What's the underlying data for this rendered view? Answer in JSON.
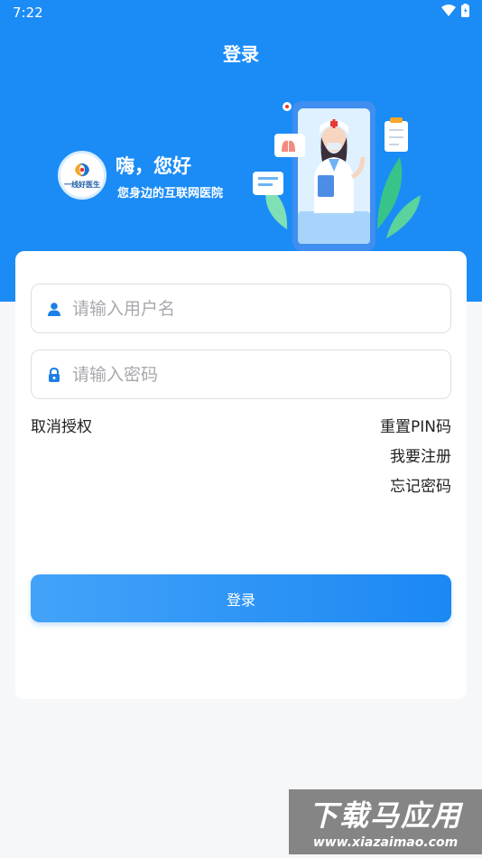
{
  "status_bar": {
    "time": "7:22"
  },
  "header": {
    "title": "登录"
  },
  "banner": {
    "logo_text": "一线好医生",
    "greeting": "嗨，您好",
    "tagline": "您身边的互联网医院"
  },
  "form": {
    "username": {
      "placeholder": "请输入用户名",
      "value": ""
    },
    "password": {
      "placeholder": "请输入密码",
      "value": ""
    },
    "links": {
      "cancel_auth": "取消授权",
      "reset_pin": "重置PIN码",
      "register": "我要注册",
      "forgot_password": "忘记密码"
    },
    "login_button": "登录"
  },
  "watermark": {
    "title": "下载马应用",
    "url": "www.xiazaimao.com"
  },
  "colors": {
    "primary": "#1b8cf6",
    "background": "#f6f7f9",
    "card": "#ffffff"
  }
}
